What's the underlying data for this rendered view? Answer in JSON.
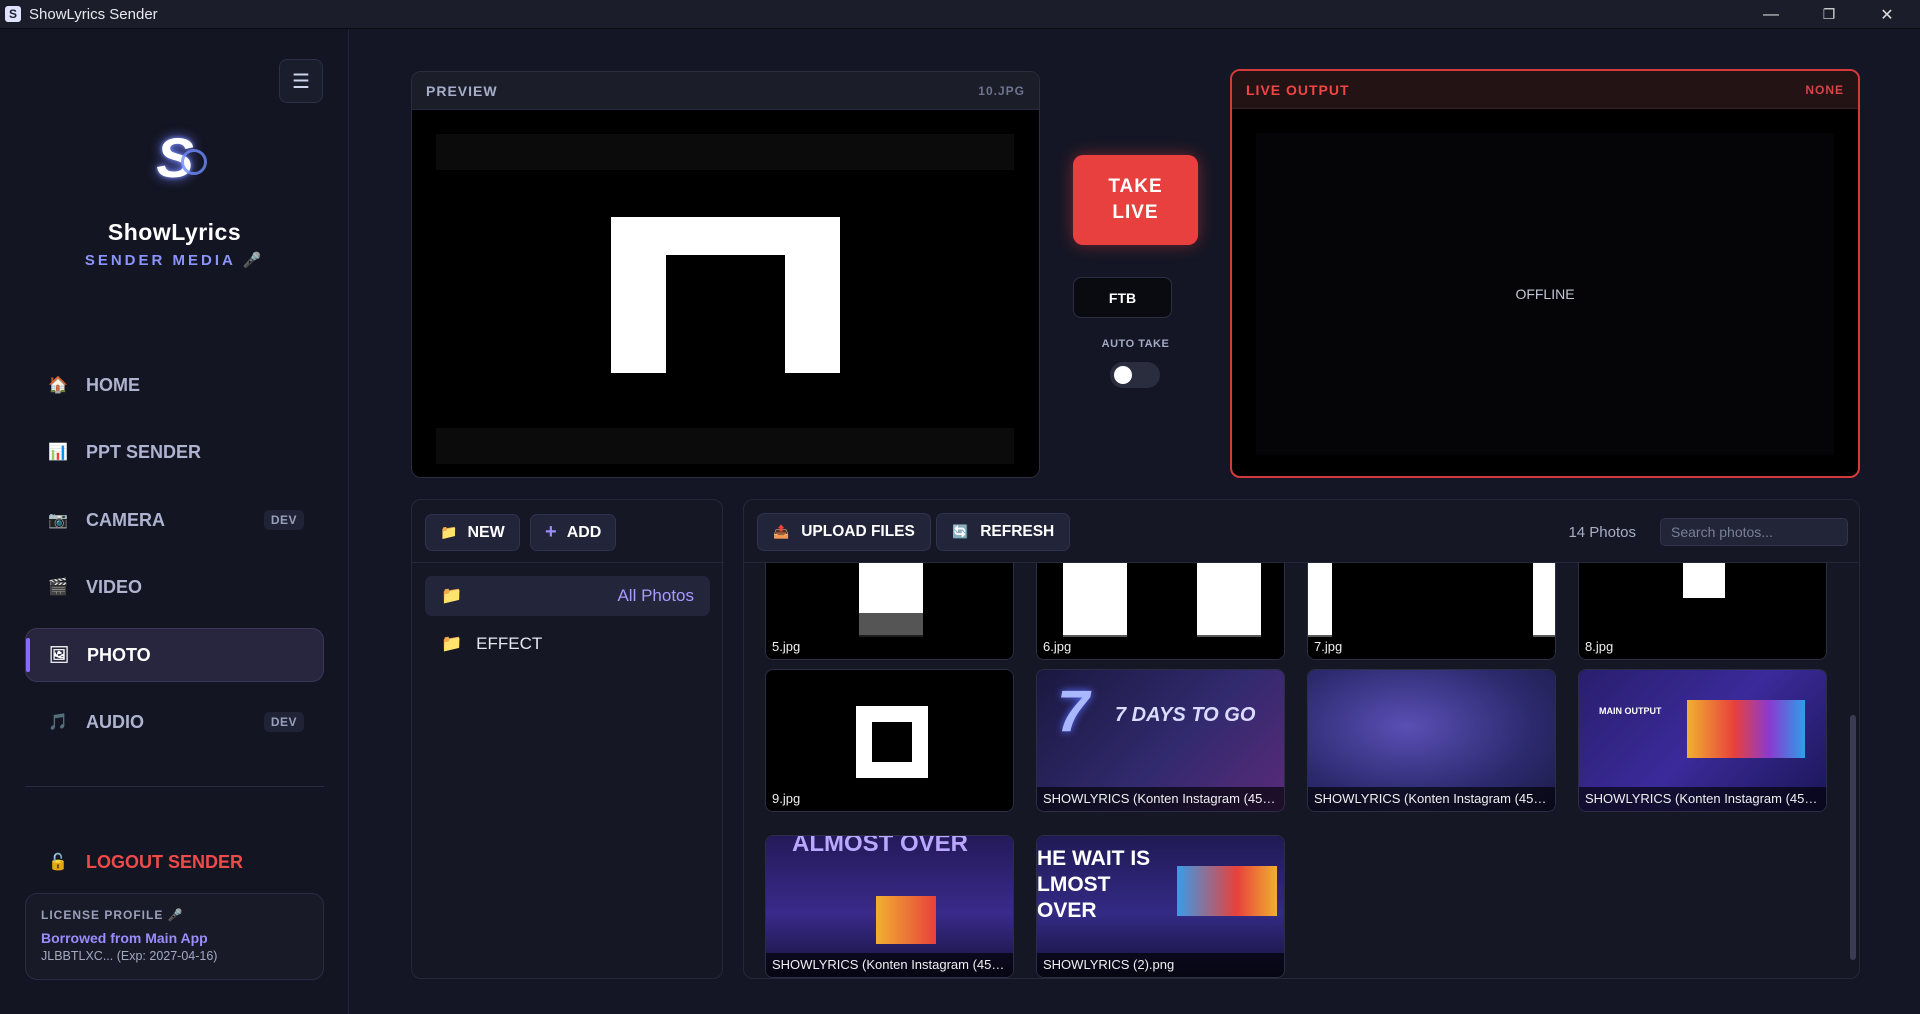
{
  "window": {
    "title": "ShowLyrics Sender",
    "app_icon": "S",
    "minimize": "—",
    "restore": "❐",
    "close": "✕"
  },
  "sidebar": {
    "menu_icon": "☰",
    "logo_letter": "S",
    "brand_name": "ShowLyrics",
    "brand_sub": "SENDER MEDIA 🎤",
    "items": [
      {
        "label": "HOME",
        "icon": "🏠",
        "badge": ""
      },
      {
        "label": "PPT SENDER",
        "icon": "📊",
        "badge": ""
      },
      {
        "label": "CAMERA",
        "icon": "📷",
        "badge": "DEV"
      },
      {
        "label": "VIDEO",
        "icon": "🎬",
        "badge": ""
      },
      {
        "label": "PHOTO",
        "icon": "🖼",
        "badge": "",
        "active": true
      },
      {
        "label": "AUDIO",
        "icon": "🎵",
        "badge": "DEV"
      }
    ],
    "logout_label": "LOGOUT SENDER",
    "logout_icon": "🔓",
    "license": {
      "title": "LICENSE PROFILE 🎤",
      "name": "Borrowed from Main App",
      "key": "JLBBTLXC... (Exp: 2027-04-16)"
    }
  },
  "preview": {
    "title": "PREVIEW",
    "file": "10.JPG"
  },
  "live": {
    "title": "LIVE OUTPUT",
    "source": "NONE",
    "status": "OFFLINE"
  },
  "controls": {
    "take_live": "TAKE LIVE",
    "ftb": "FTB",
    "auto_take": "AUTO TAKE",
    "auto_take_on": false
  },
  "folders": {
    "new_label": "NEW",
    "new_icon": "📁",
    "add_label": "ADD",
    "add_icon": "+",
    "items": [
      {
        "label": "All Photos",
        "icon": "📁",
        "selected": true
      },
      {
        "label": "EFFECT",
        "icon": "📁",
        "selected": false
      }
    ]
  },
  "photos": {
    "upload_label": "UPLOAD FILES",
    "upload_icon": "📤",
    "refresh_label": "REFRESH",
    "refresh_icon": "🔄",
    "count": "14 Photos",
    "search_placeholder": "Search photos...",
    "items": [
      {
        "name": "5.jpg"
      },
      {
        "name": "6.jpg"
      },
      {
        "name": "7.jpg"
      },
      {
        "name": "8.jpg"
      },
      {
        "name": "9.jpg"
      },
      {
        "name": "SHOWLYRICS (Konten Instagram (45)) (...",
        "art_text": "7 DAYS TO GO"
      },
      {
        "name": "SHOWLYRICS (Konten Instagram (45)) (..."
      },
      {
        "name": "SHOWLYRICS (Konten Instagram (45)) (...",
        "art_text": "MAIN OUTPUT"
      },
      {
        "name": "SHOWLYRICS (Konten Instagram (45)) (...",
        "art_text": "ALMOST OVER"
      },
      {
        "name": "SHOWLYRICS (2).png",
        "art_text": "HE WAIT IS LMOST OVER"
      }
    ]
  }
}
